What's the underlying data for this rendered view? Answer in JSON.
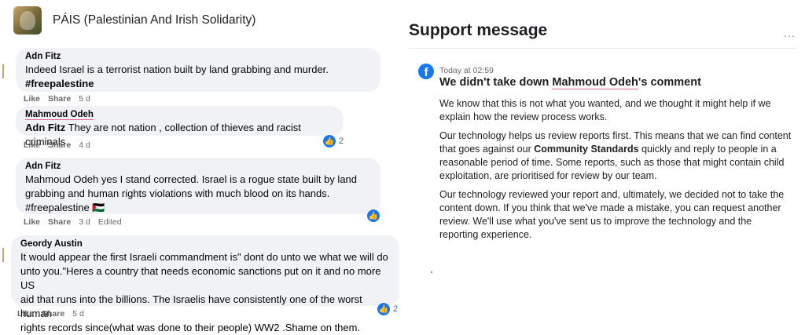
{
  "group": {
    "name": "PÁIS (Palestinian And Irish Solidarity)"
  },
  "comments": [
    {
      "author": "Adn Fitz",
      "lines": [
        "Indeed Israel is a terrorist nation built by land grabbing and murder.",
        "#freepalestine"
      ],
      "like": "Like",
      "share": "Share",
      "time": "5 d"
    },
    {
      "author": "Mahmoud Odeh",
      "mention": "Adn Fitz",
      "text": " They are not nation , collection of thieves and racist criminals .",
      "like": "Like",
      "share": "Share",
      "time": "4 d",
      "reactions": "2"
    },
    {
      "author": "Adn Fitz",
      "lines": [
        "Mahmoud Odeh yes I stand corrected. Israel is a rogue state built by land",
        "grabbing and human rights violations with much blood on its hands.",
        "#freepalestine 🇵🇸"
      ],
      "like": "Like",
      "share": "Share",
      "time": "3 d",
      "edited": "Edited"
    },
    {
      "author": "Geordy Austin",
      "lines": [
        "It would appear the first Israeli commandment is\" dont do unto we what we will do",
        "unto you.\"Heres a country that needs economic sanctions put on it and no more US",
        "aid that runs into the billions. The Israelis have consistently one of the worst human",
        "rights records since(what was done to their people) WW2 .Shame on them."
      ],
      "like": "Like",
      "share": "Share",
      "time": "5 d",
      "reactions": "2"
    }
  ],
  "support": {
    "title": "Support message",
    "menu": "...",
    "time": "Today at 02:59",
    "headline_pre": "We didn't take down ",
    "headline_name": "Mahmoud Odeh",
    "headline_post": "'s comment",
    "p1": "We know that this is not what you wanted, and we thought it might help if we explain how the review process works.",
    "p2_pre": "Our technology helps us review reports first. This means that we can find content that goes against our ",
    "p2_bold": "Community Standards",
    "p2_post": " quickly and reply to people in a reasonable period of time. Some reports, such as those that might contain child exploitation, are prioritised for review by our team.",
    "p3": "Our technology reviewed your report and, ultimately, we decided not to take the content down. If you think that we've made a mistake, you can request another review. We'll use what you've sent us to improve the technology and the reporting experience."
  }
}
